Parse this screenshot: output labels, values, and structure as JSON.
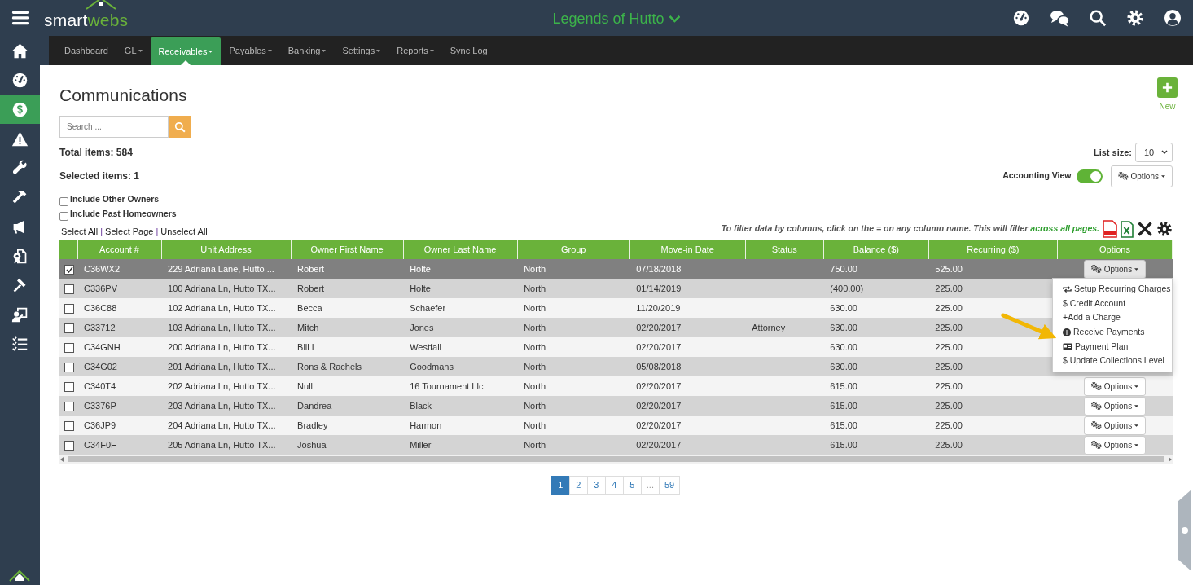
{
  "app": {
    "logo": [
      "smart",
      "webs"
    ],
    "title": "Legends of Hutto"
  },
  "sidebar": {
    "items": [
      {
        "kind": "home",
        "selected": false
      },
      {
        "kind": "gauge",
        "selected": false
      },
      {
        "kind": "dollar",
        "selected": true
      },
      {
        "kind": "warning",
        "selected": false
      },
      {
        "kind": "wrench",
        "selected": false
      },
      {
        "kind": "hammer",
        "selected": false
      },
      {
        "kind": "megaphone",
        "selected": false
      },
      {
        "kind": "certificate",
        "selected": false
      },
      {
        "kind": "gavel",
        "selected": false
      },
      {
        "kind": "presenter",
        "selected": false
      },
      {
        "kind": "checklist",
        "selected": false
      }
    ]
  },
  "nav": [
    {
      "label": "Dashboard",
      "dropdown": false,
      "selected": false
    },
    {
      "label": "GL",
      "dropdown": true,
      "selected": false
    },
    {
      "label": "Receivables",
      "dropdown": true,
      "selected": true
    },
    {
      "label": "Payables",
      "dropdown": true,
      "selected": false
    },
    {
      "label": "Banking",
      "dropdown": true,
      "selected": false
    },
    {
      "label": "Settings",
      "dropdown": true,
      "selected": false
    },
    {
      "label": "Reports",
      "dropdown": true,
      "selected": false
    },
    {
      "label": "Sync Log",
      "dropdown": false,
      "selected": false
    }
  ],
  "page": {
    "title": "Communications",
    "search_placeholder": "Search ...",
    "new_label": "New",
    "total_items": "Total items: 584",
    "selected_items": "Selected items: 1",
    "list_size_label": "List size:",
    "list_size": "10",
    "accounting_view": {
      "label": "Accounting View",
      "on": true
    },
    "options_label": "Options"
  },
  "filters": [
    {
      "label": "Include Other Owners",
      "checked": false
    },
    {
      "label": "Include Past Homeowners",
      "checked": false
    }
  ],
  "select_links": [
    "Select All",
    "Select Page",
    "Unselect All"
  ],
  "select_separator": "|",
  "filter_hint": {
    "text": "To filter data by columns, click on the = on any column name. This will filter ",
    "emphasis": "across all pages."
  },
  "table": {
    "columns": [
      "Account #",
      "Unit Address",
      "Owner First Name",
      "Owner Last Name",
      "Group",
      "Move-in Date",
      "Status",
      "Balance ($)",
      "Recurring ($)",
      "Options"
    ],
    "rows": [
      {
        "selected": true,
        "cells": [
          "C36WX2",
          "229 Adriana Lane, Hutto ...",
          "Robert",
          "Holte",
          "North",
          "07/18/2018",
          "",
          "750.00",
          "525.00"
        ],
        "options": "Options"
      },
      {
        "selected": false,
        "cells": [
          "C336PV",
          "100 Adriana Ln, Hutto TX...",
          "Robert",
          "Holte",
          "North",
          "01/14/2019",
          "",
          "(400.00)",
          "225.00"
        ]
      },
      {
        "selected": false,
        "cells": [
          "C36C88",
          "102 Adriana Ln, Hutto TX...",
          "Becca",
          "Schaefer",
          "North",
          "11/20/2019",
          "",
          "630.00",
          "225.00"
        ]
      },
      {
        "selected": false,
        "cells": [
          "C33712",
          "103 Adriana Ln, Hutto TX...",
          "Mitch",
          "Jones",
          "North",
          "02/20/2017",
          "Attorney",
          "630.00",
          "225.00"
        ]
      },
      {
        "selected": false,
        "cells": [
          "C34GNH",
          "200 Adriana Ln, Hutto TX...",
          "Bill L",
          "Westfall",
          "North",
          "02/20/2017",
          "",
          "630.00",
          "225.00"
        ]
      },
      {
        "selected": false,
        "cells": [
          "C34G02",
          "201 Adriana Ln, Hutto TX...",
          "Rons & Rachels",
          "Goodmans",
          "North",
          "05/08/2018",
          "",
          "630.00",
          "225.00"
        ]
      },
      {
        "selected": false,
        "cells": [
          "C340T4",
          "202 Adriana Ln, Hutto TX...",
          "Null",
          "16 Tournament Llc",
          "North",
          "02/20/2017",
          "",
          "615.00",
          "225.00"
        ],
        "options": "Options"
      },
      {
        "selected": false,
        "cells": [
          "C3376P",
          "203 Adriana Ln, Hutto TX...",
          "Dandrea",
          "Black",
          "North",
          "02/20/2017",
          "",
          "615.00",
          "225.00"
        ],
        "options": "Options"
      },
      {
        "selected": false,
        "cells": [
          "C36JP9",
          "204 Adriana Ln, Hutto TX...",
          "Bradley",
          "Harmon",
          "North",
          "02/20/2017",
          "",
          "615.00",
          "225.00"
        ],
        "options": "Options"
      },
      {
        "selected": false,
        "cells": [
          "C34F0F",
          "205 Adriana Ln, Hutto TX...",
          "Joshua",
          "Miller",
          "North",
          "02/20/2017",
          "",
          "615.00",
          "225.00"
        ],
        "options": "Options"
      }
    ]
  },
  "options_menu": {
    "items": [
      {
        "kind": "repeat",
        "label": "Setup Recurring Charges"
      },
      {
        "kind": "text",
        "label": "$ Credit Account"
      },
      {
        "kind": "text",
        "label": "+Add a Charge"
      },
      {
        "kind": "coin",
        "label": "Receive Payments"
      },
      {
        "kind": "card",
        "label": "Payment Plan"
      },
      {
        "kind": "text",
        "label": "$ Update Collections Level"
      }
    ]
  },
  "pagination": [
    {
      "label": "1",
      "selected": true,
      "disabled": false
    },
    {
      "label": "2",
      "selected": false,
      "disabled": false
    },
    {
      "label": "3",
      "selected": false,
      "disabled": false
    },
    {
      "label": "4",
      "selected": false,
      "disabled": false
    },
    {
      "label": "5",
      "selected": false,
      "disabled": false
    },
    {
      "label": "...",
      "selected": false,
      "disabled": true
    },
    {
      "label": "59",
      "selected": false,
      "disabled": false
    }
  ]
}
